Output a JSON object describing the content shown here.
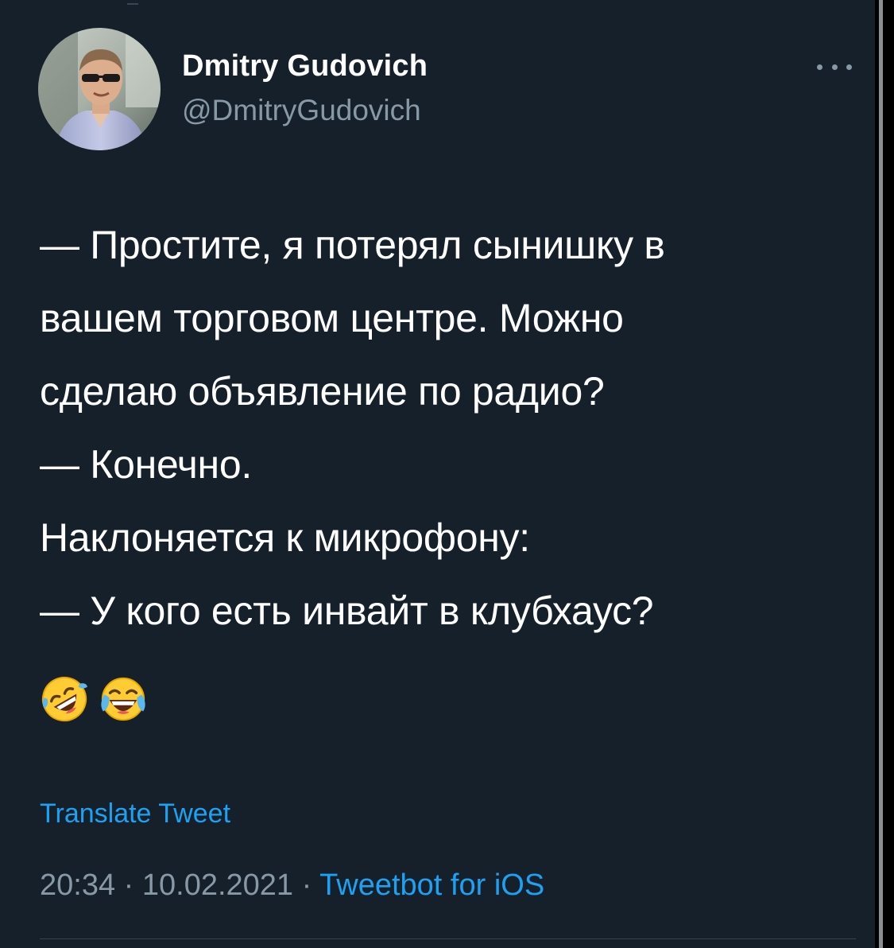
{
  "tweet": {
    "author": {
      "display_name": "Dmitry Gudovich",
      "handle": "@DmitryGudovich",
      "avatar_icon": "user-photo-avatar"
    },
    "more_icon": "ellipsis-icon",
    "lines": [
      "— Простите, я потерял сынишку в",
      "вашем торговом центре. Можно",
      "сделаю объявление по радио?",
      "— Конечно.",
      "Наклоняется к микрофону:",
      "— У кого есть инвайт в клубхаус?"
    ],
    "emojis": [
      "rolling-on-floor-laughing-emoji",
      "face-with-tears-of-joy-emoji"
    ],
    "translate_label": "Translate Tweet",
    "time": "20:34",
    "separator": " · ",
    "date": "10.02.2021",
    "source": "Tweetbot for iOS"
  },
  "colors": {
    "background": "#15202b",
    "text_primary": "#ffffff",
    "text_secondary": "#8899a6",
    "accent": "#1da1f2",
    "divider": "#38444d"
  }
}
